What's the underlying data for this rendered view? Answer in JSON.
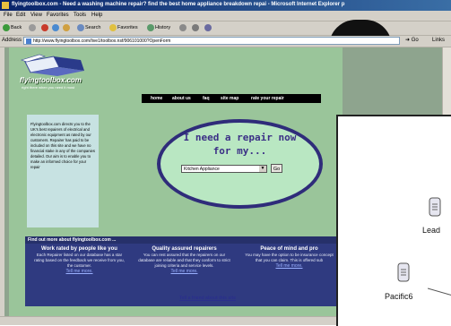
{
  "window": {
    "title": "flyingtoolbox.com - Need a washing machine repair? find the best home appliance breakdown repai - Microsoft Internet Explorer p"
  },
  "menu": [
    "File",
    "Edit",
    "View",
    "Favorites",
    "Tools",
    "Help"
  ],
  "toolbar": {
    "back": "Back",
    "search": "Search",
    "favorites": "Favorites",
    "history": "History"
  },
  "address": {
    "label": "Address",
    "url": "http://www.flyingtoolbox.com/live1/toolbox.nsf/906101000?OpenForm",
    "go": "Go",
    "links": "Links"
  },
  "site": {
    "logo_text": "flyingtoolbox.com",
    "tagline": "right there when you need it most",
    "nav": [
      "home",
      "about us",
      "faq",
      "site map",
      "rate your repair"
    ],
    "intro": "Flyingtoolbox.com directs you to the UK's best repairers of electrical and electronic equipment as rated by our customers. Repairer has paid to be included on this site and we have no financial stake in any of the companies detailed. Our aim is to enable you to make an informed choice for your repair",
    "repair_title_1": "I need a repair now",
    "repair_title_2": "for my...",
    "select_value": "Kitchen Appliance",
    "go_button": "Go",
    "info_bar": "Find out more about flyingtoolbox.com ...",
    "columns": [
      {
        "title": "Work rated by people like you",
        "text": "Each Repairer listed on our database has a star rating based on the feedback we receive from you, the customer.",
        "link": "Tell me more."
      },
      {
        "title": "Quality assured repairers",
        "text": "You can rest assured that the repairers on our database are reliable and that they conform to strict joining criteria and service levels.",
        "link": "Tell me more."
      },
      {
        "title": "Peace of mind and pro",
        "text": "You may have the option to be insurance concept that you can claim. This is offered sub",
        "link": "Tell me more."
      }
    ],
    "tell_friend": "Tell a friend about this site"
  },
  "overlay": {
    "nodes": [
      {
        "label": "Lead"
      },
      {
        "label": "Pacific6"
      }
    ]
  }
}
